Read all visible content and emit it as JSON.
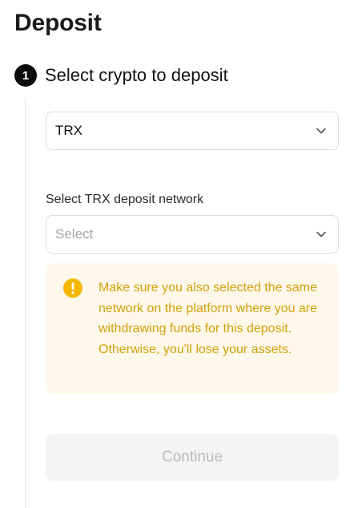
{
  "page": {
    "title": "Deposit"
  },
  "step": {
    "number": "1",
    "title": "Select crypto to deposit"
  },
  "crypto_select": {
    "value": "TRX",
    "icon": "chevron-down-icon"
  },
  "network": {
    "label": "Select TRX deposit network",
    "placeholder": "Select",
    "icon": "chevron-down-icon"
  },
  "warning": {
    "icon": "exclamation-circle-icon",
    "text": "Make sure you also selected the same network on the platform where you are withdrawing funds for this deposit. Otherwise, you'll lose your assets."
  },
  "actions": {
    "continue_label": "Continue",
    "continue_enabled": false
  },
  "colors": {
    "warning_background": "#fdf8ea",
    "warning_text": "#d4a10a",
    "warning_icon": "#f5b800",
    "disabled_button_background": "#f4f4f4",
    "disabled_button_text": "#b9b9b9"
  }
}
